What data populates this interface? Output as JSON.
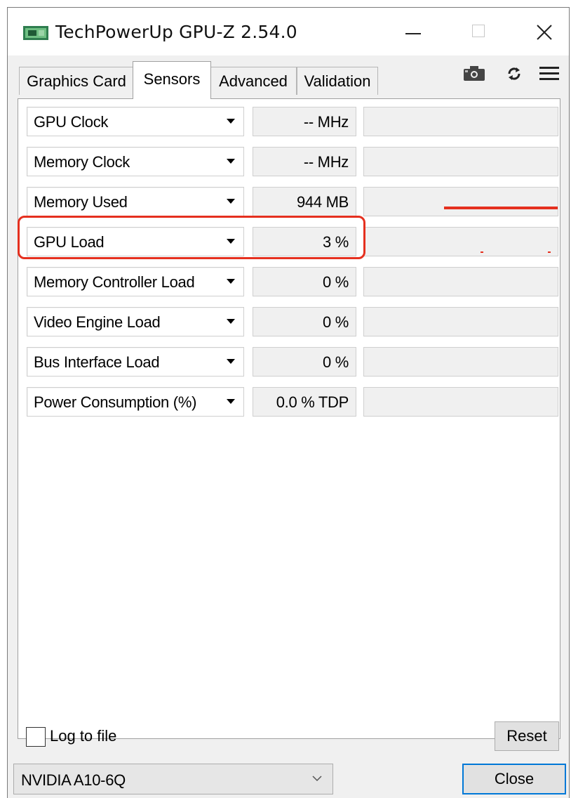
{
  "window": {
    "title": "TechPowerUp GPU-Z 2.54.0"
  },
  "tabs": [
    {
      "label": "Graphics Card"
    },
    {
      "label": "Sensors"
    },
    {
      "label": "Advanced"
    },
    {
      "label": "Validation"
    }
  ],
  "toolbar_icons": [
    "camera-icon",
    "refresh-icon",
    "menu-icon"
  ],
  "sensors": [
    {
      "name": "GPU Clock",
      "value": "-- MHz"
    },
    {
      "name": "Memory Clock",
      "value": "-- MHz"
    },
    {
      "name": "Memory Used",
      "value": "944 MB"
    },
    {
      "name": "GPU Load",
      "value": "3 %"
    },
    {
      "name": "Memory Controller Load",
      "value": "0 %"
    },
    {
      "name": "Video Engine Load",
      "value": "0 %"
    },
    {
      "name": "Bus Interface Load",
      "value": "0 %"
    },
    {
      "name": "Power Consumption (%)",
      "value": "0.0 % TDP"
    }
  ],
  "footer": {
    "log_label": "Log to file",
    "reset_label": "Reset",
    "device": "NVIDIA A10-6Q",
    "close_label": "Close"
  },
  "colors": {
    "graph_line": "#e5301f",
    "highlight": "#e5301f",
    "focus_border": "#0078d7"
  }
}
